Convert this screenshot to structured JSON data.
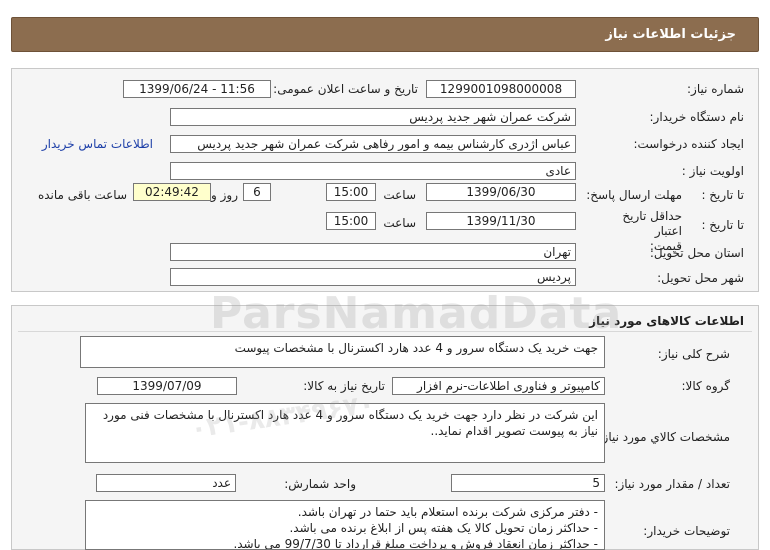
{
  "header": {
    "title": "جزئیات اطلاعات نیاز"
  },
  "need_info": {
    "need_number_label": "شماره نیاز:",
    "need_number": "1299001098000008",
    "announce_label": "تاریخ و ساعت اعلان عمومی:",
    "announce_value": "1399/06/24 - 11:56",
    "buyer_org_label": "نام دستگاه خریدار:",
    "buyer_org": "شرکت عمران شهر جدید پردیس",
    "creator_label": "ایجاد کننده درخواست:",
    "creator": "عباس اژدری کارشناس بیمه و امور رفاهی شرکت عمران شهر جدید پردیس",
    "contact_link": "اطلاعات تماس خریدار",
    "priority_label": "اولویت نیاز :",
    "priority": "عادی",
    "reply_deadline_label": "مهلت ارسال پاسخ:",
    "until_date_label": "تا تاریخ :",
    "reply_date": "1399/06/30",
    "time_label": "ساعت",
    "reply_time": "15:00",
    "days_value": "6",
    "days_label": "روز و",
    "remaining_time": "02:49:42",
    "remaining_label": "ساعت باقی مانده",
    "price_validity_label": "حداقل تاریخ اعتبار قیمت:",
    "price_validity_until_label": "تا تاریخ :",
    "price_validity_date": "1399/11/30",
    "price_validity_time_label": "ساعت",
    "price_validity_time": "15:00",
    "province_label": "استان محل تحویل:",
    "province": "تهران",
    "city_label": "شهر محل تحویل:",
    "city": "پردیس"
  },
  "goods": {
    "section_title": "اطلاعات کالاهای مورد نیاز",
    "summary_label": "شرح کلی نیاز:",
    "summary": "جهت خرید یک دستگاه سرور و  4 عدد هارد اکسترنال با مشخصات پیوست",
    "group_label": "گروه کالا:",
    "group": "کامپیوتر و فناوری اطلاعات-نرم افزار",
    "need_date_label": "تاریخ نیاز به کالا:",
    "need_date": "1399/07/09",
    "spec_label": "مشخصات کالاي مورد نياز:",
    "spec": "این شرکت در نظر دارد جهت خرید یک دستگاه سرور و  4 عدد هارد اکسترنال با مشخصات فنی مورد نیاز به پیوست تصویر اقدام نماید..",
    "qty_label": "تعداد / مقدار مورد نیاز:",
    "qty": "5",
    "unit_label": "واحد شمارش:",
    "unit": "عدد",
    "buyer_notes_label": "توضیحات خریدار:",
    "buyer_notes": [
      "- دفتر مرکزی شرکت برنده استعلام باید حتما در تهران باشد.",
      "- حداکثر زمان تحویل کالا یک هفته پس از ابلاغ برنده می باشد.",
      "- حداکثر زمان انعقاد فروش و پرداخت مبلغ قرارداد تا 99/7/30 می باشد."
    ]
  },
  "watermark": {
    "brand": "ParsNamadData",
    "phone": "۰۲۱-۸۸۳۴۹۶۷۰"
  }
}
